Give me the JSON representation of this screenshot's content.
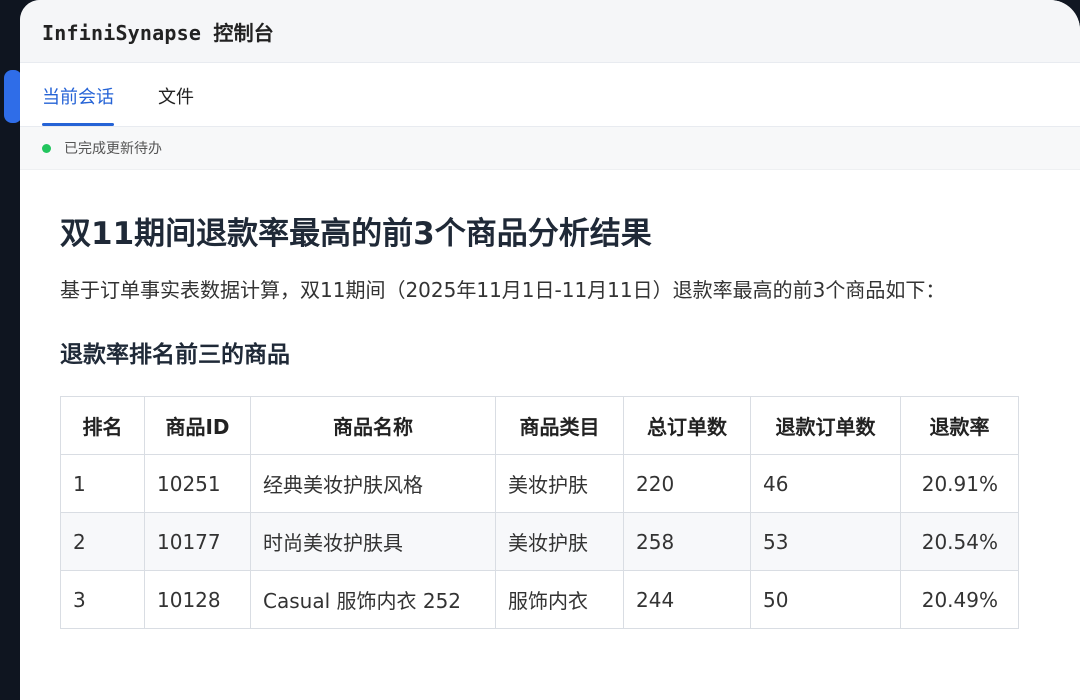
{
  "app": {
    "title": "InfiniSynapse 控制台"
  },
  "tabs": [
    {
      "label": "当前会话",
      "active": true
    },
    {
      "label": "文件",
      "active": false
    }
  ],
  "status": {
    "text": "已完成更新待办",
    "color": "#22c55e"
  },
  "main": {
    "title": "双11期间退款率最高的前3个商品分析结果",
    "intro": "基于订单事实表数据计算，双11期间（2025年11月1日-11月11日）退款率最高的前3个商品如下：",
    "section_title": "退款率排名前三的商品",
    "table": {
      "headers": [
        "排名",
        "商品ID",
        "商品名称",
        "商品类目",
        "总订单数",
        "退款订单数",
        "退款率"
      ],
      "rows": [
        [
          "1",
          "10251",
          "经典美妆护肤风格",
          "美妆护肤",
          "220",
          "46",
          "20.91%"
        ],
        [
          "2",
          "10177",
          "时尚美妆护肤具",
          "美妆护肤",
          "258",
          "53",
          "20.54%"
        ],
        [
          "3",
          "10128",
          "Casual 服饰内衣 252",
          "服饰内衣",
          "244",
          "50",
          "20.49%"
        ]
      ]
    }
  },
  "colors": {
    "accent": "#2563d6",
    "rail_accent": "#2f6de8",
    "background": "#111722"
  }
}
